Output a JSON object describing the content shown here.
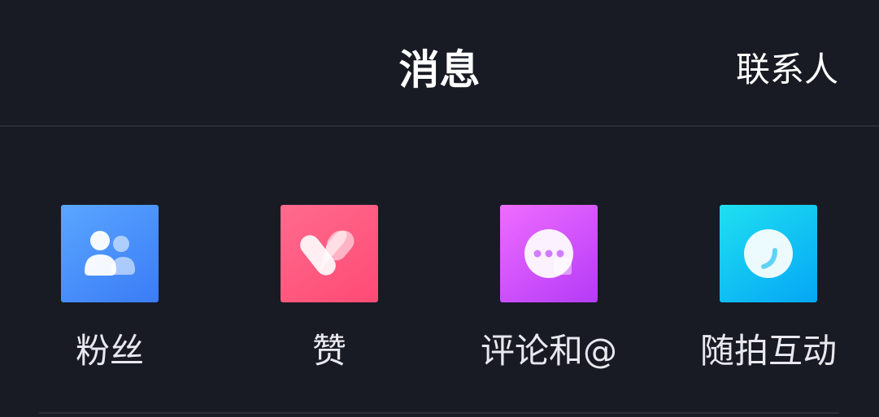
{
  "header": {
    "title": "消息",
    "contacts_label": "联系人"
  },
  "shortcuts": [
    {
      "label": "粉丝",
      "icon": "fans-icon",
      "color": "#4a90ff"
    },
    {
      "label": "赞",
      "icon": "heart-icon",
      "color": "#ff5a80"
    },
    {
      "label": "评论和@",
      "icon": "comment-bubble-icon",
      "color": "#d252fb"
    },
    {
      "label": "随拍互动",
      "icon": "moment-circle-icon",
      "color": "#0fc3f3"
    }
  ],
  "colors": {
    "background": "#181a24",
    "divider": "#2b2d38",
    "text": "#ffffff"
  }
}
